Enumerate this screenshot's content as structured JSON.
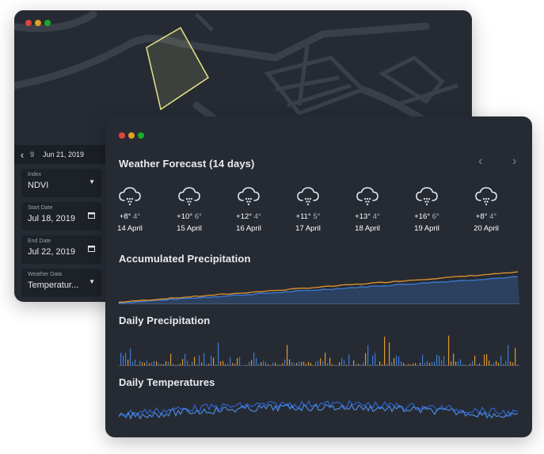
{
  "back_window": {
    "controls": {
      "close_color": "#e0443e",
      "min_color": "#dea123",
      "max_color": "#1aab29"
    },
    "date_bar": {
      "prev_label": "‹",
      "day_fragment": "9",
      "date_label": "Jun 21, 2019"
    },
    "fields": [
      {
        "label": "Index",
        "value": "NDVI",
        "icon": "caret-down-icon"
      },
      {
        "label": "Start Date",
        "value": "Jul 18, 2019",
        "icon": "calendar-icon"
      },
      {
        "label": "End Date",
        "value": "Jul 22, 2019",
        "icon": "calendar-icon"
      },
      {
        "label": "Weather Data",
        "value": "Temperatur...",
        "icon": "caret-down-icon"
      }
    ]
  },
  "front_window": {
    "forecast": {
      "title": "Weather Forecast (14 days)",
      "prev_label": "‹",
      "next_label": "›",
      "days": [
        {
          "high": "+8°",
          "low": "4°",
          "date": "14 April",
          "icon": "snow-cloud-icon"
        },
        {
          "high": "+10°",
          "low": "6°",
          "date": "15 April",
          "icon": "snow-cloud-icon"
        },
        {
          "high": "+12°",
          "low": "4°",
          "date": "16 April",
          "icon": "snow-cloud-icon"
        },
        {
          "high": "+11°",
          "low": "5°",
          "date": "17 April",
          "icon": "snow-cloud-icon"
        },
        {
          "high": "+13°",
          "low": "4°",
          "date": "18 April",
          "icon": "snow-cloud-icon"
        },
        {
          "high": "+16°",
          "low": "6°",
          "date": "19 April",
          "icon": "snow-cloud-icon"
        },
        {
          "high": "+8°",
          "low": "4°",
          "date": "20 April",
          "icon": "snow-cloud-icon"
        }
      ]
    },
    "accumulated_title": "Accumulated Precipitation",
    "daily_precip_title": "Daily Precipitation",
    "daily_temp_title": "Daily Temperatures"
  },
  "colors": {
    "blue": "#3d7bd6",
    "orange": "#e2962e",
    "background": "#262b33",
    "map_field": "#e8e48a"
  }
}
